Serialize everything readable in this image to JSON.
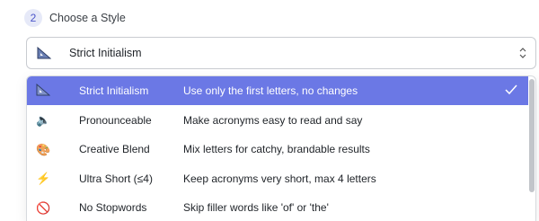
{
  "step": {
    "number": "2",
    "title": "Choose a Style"
  },
  "select": {
    "icon": "triangular-ruler-icon",
    "value": "Strict Initialism"
  },
  "options": [
    {
      "icon": "triangular-ruler-icon",
      "glyph": "📐",
      "name": "Strict Initialism",
      "description": "Use only the first letters, no changes",
      "selected": true
    },
    {
      "icon": "speaker-icon",
      "glyph": "🔈",
      "name": "Pronounceable",
      "description": "Make acronyms easy to read and say",
      "selected": false
    },
    {
      "icon": "palette-icon",
      "glyph": "🎨",
      "name": "Creative Blend",
      "description": "Mix letters for catchy, brandable results",
      "selected": false
    },
    {
      "icon": "lightning-icon",
      "glyph": "⚡",
      "name": "Ultra Short (≤4)",
      "description": "Keep acronyms very short, max 4 letters",
      "selected": false
    },
    {
      "icon": "no-entry-icon",
      "glyph": "🚫",
      "name": "No Stopwords",
      "description": "Skip filler words like 'of' or 'the'",
      "selected": false
    }
  ],
  "colors": {
    "accent": "#6b78e5",
    "badge_bg": "#e6e9f8",
    "badge_text": "#4a54c9"
  }
}
